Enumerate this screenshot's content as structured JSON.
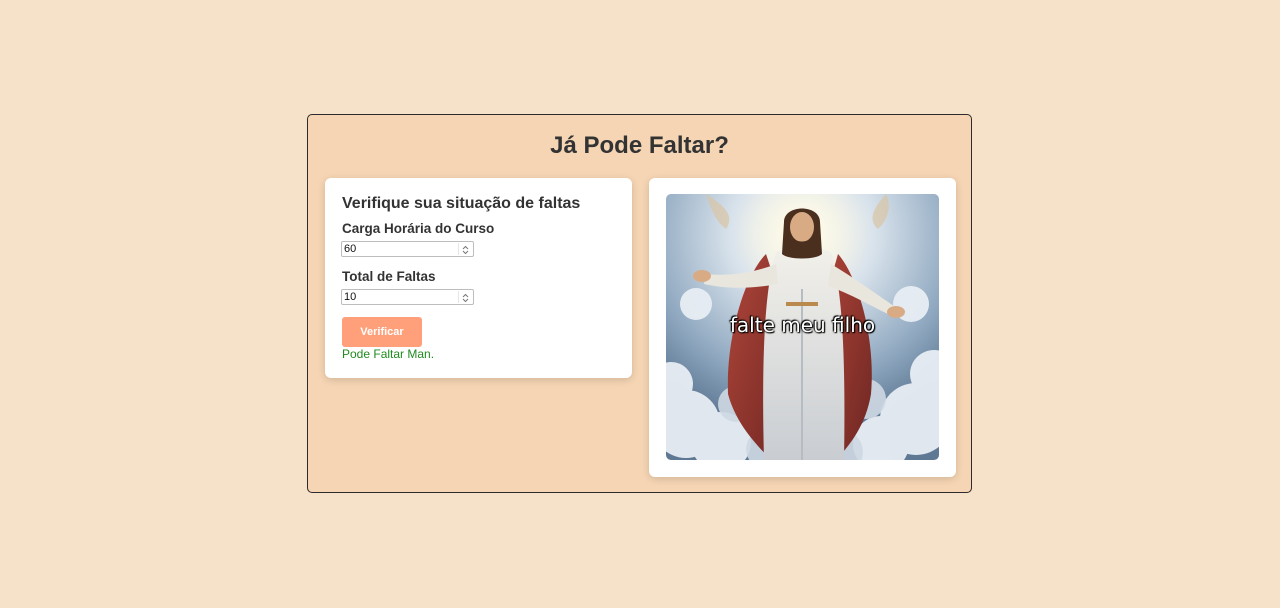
{
  "title": "Já Pode Faltar?",
  "form": {
    "heading": "Verifique sua situação de faltas",
    "hours_label": "Carga Horária do Curso",
    "hours_value": "60",
    "absences_label": "Total de Faltas",
    "absences_value": "10",
    "button_label": "Verificar",
    "result": "Pode Faltar Man."
  },
  "meme": {
    "caption": "falte meu filho"
  },
  "colors": {
    "page_background": "#f5e2c8",
    "panel_background": "#f5d5b3",
    "button": "#ffa07a",
    "result_text": "#1f8a1f"
  }
}
